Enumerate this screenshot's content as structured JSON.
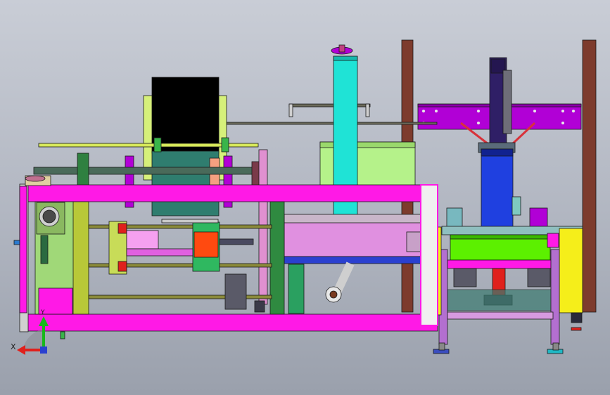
{
  "triad": {
    "x_label": "X",
    "y_label": "Y",
    "x_color": "#e0201c",
    "y_color": "#18b81c"
  },
  "colors": {
    "frame_magenta": "#ff19e6",
    "cyan_column": "#1fe3d6",
    "purple_beam": "#b100d6",
    "brown_posts": "#7d3b2d",
    "olive": "#a6b83a",
    "blue_block": "#1f40e0",
    "lime": "#5cf000",
    "yellow": "#f5ee1a"
  }
}
